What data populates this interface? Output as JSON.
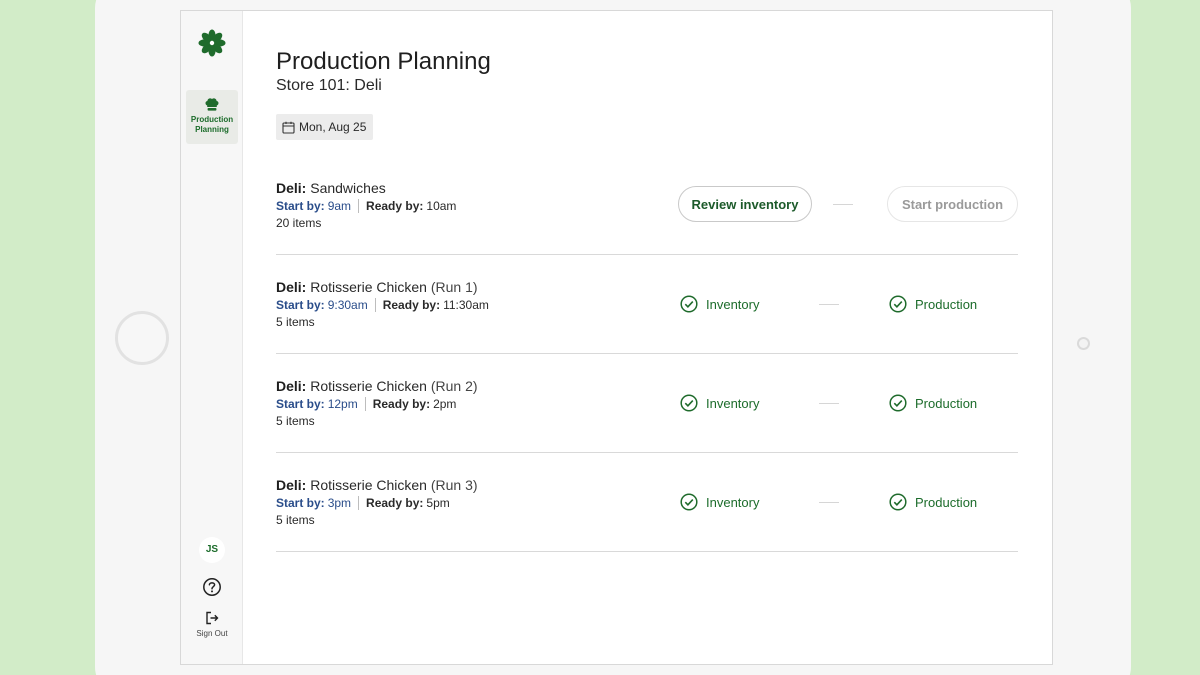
{
  "app": {
    "brand_color": "#1c6c2b",
    "logo_icon": "leaf-wheel-logo"
  },
  "sidebar": {
    "nav_items": [
      {
        "label": "Production Planning",
        "icon": "chef-hat-icon",
        "active": true
      }
    ],
    "avatar_initials": "JS",
    "help_icon": "help-circle-icon",
    "sign_out_label": "Sign Out"
  },
  "header": {
    "title": "Production Planning",
    "subtitle": "Store 101: Deli",
    "date": "Mon, Aug 25"
  },
  "runs": [
    {
      "department": "Deli:",
      "name": "Sandwiches",
      "run": "",
      "start_label": "Start by:",
      "start_time": "9am",
      "ready_label": "Ready by:",
      "ready_time": "10am",
      "items": "20 items",
      "review_inventory_label": "Review inventory",
      "start_production_label": "Start production"
    },
    {
      "department": "Deli:",
      "name": "Rotisserie Chicken",
      "run": "(Run 1)",
      "start_label": "Start by:",
      "start_time": "9:30am",
      "ready_label": "Ready by:",
      "ready_time": "11:30am",
      "items": "5 items",
      "inventory_label": "Inventory",
      "production_label": "Production"
    },
    {
      "department": "Deli:",
      "name": "Rotisserie Chicken",
      "run": "(Run 2)",
      "start_label": "Start by:",
      "start_time": "12pm",
      "ready_label": "Ready by:",
      "ready_time": "2pm",
      "items": "5 items",
      "inventory_label": "Inventory",
      "production_label": "Production"
    },
    {
      "department": "Deli:",
      "name": "Rotisserie Chicken",
      "run": "(Run 3)",
      "start_label": "Start by:",
      "start_time": "3pm",
      "ready_label": "Ready by:",
      "ready_time": "5pm",
      "items": "5 items",
      "inventory_label": "Inventory",
      "production_label": "Production"
    }
  ]
}
